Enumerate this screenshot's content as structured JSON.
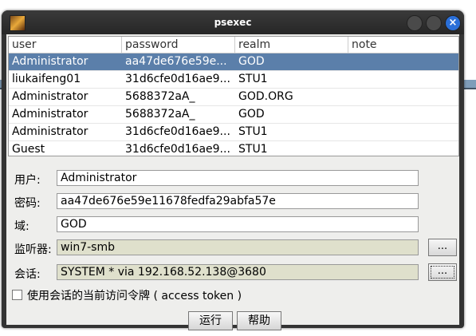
{
  "window": {
    "title": "psexec"
  },
  "table": {
    "headers": [
      "user",
      "password",
      "realm",
      "note"
    ],
    "rows": [
      [
        "Administrator",
        "aa47de676e59e...",
        "GOD",
        ""
      ],
      [
        "liukaifeng01",
        "31d6cfe0d16ae9...",
        "STU1",
        ""
      ],
      [
        "Administrator",
        "5688372aA_",
        "GOD.ORG",
        ""
      ],
      [
        "Administrator",
        "5688372aA_",
        "GOD",
        ""
      ],
      [
        "Administrator",
        "31d6cfe0d16ae9...",
        "STU1",
        ""
      ],
      [
        "Guest",
        "31d6cfe0d16ae9...",
        "STU1",
        ""
      ]
    ]
  },
  "form": {
    "user_label": "用户:",
    "user_value": "Administrator",
    "password_label": "密码:",
    "password_value": "aa47de676e59e11678fedfa29abfa57e",
    "domain_label": "域:",
    "domain_value": "GOD",
    "listener_label": "监听器:",
    "listener_value": "win7-smb",
    "session_label": "会话:",
    "session_value": "SYSTEM * via  192.168.52.138@3680",
    "browse_label": "...",
    "token_label": "使用会话的当前访问令牌 ( access token )",
    "token_checked": false
  },
  "buttons": {
    "run": "运行",
    "help": "帮助"
  }
}
